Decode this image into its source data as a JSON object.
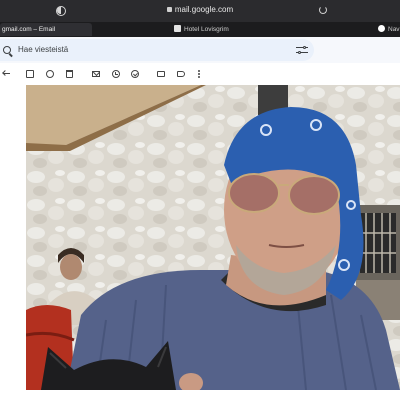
{
  "browser": {
    "url": "mail.google.com",
    "tabs": [
      {
        "label": "gmail.com – Email",
        "favicon": "gmail-favicon",
        "active": true
      },
      {
        "label": "Hotel Lovisgrim",
        "favicon": "page-favicon",
        "active": false
      },
      {
        "label": "Nav",
        "favicon": "round-favicon",
        "active": false
      }
    ]
  },
  "search": {
    "placeholder": "Hae viesteistä",
    "icon": "search-icon",
    "filter_icon": "tune-icon"
  },
  "toolbar": {
    "icons": [
      "back-icon",
      "archive-icon",
      "report-spam-icon",
      "delete-icon",
      "mark-unread-icon",
      "snooze-icon",
      "add-task-icon",
      "move-to-icon",
      "label-icon",
      "more-icon"
    ]
  },
  "email_image": {
    "description_icon": "attached-photo"
  },
  "colors": {
    "chrome_bg": "#202124",
    "search_bg": "#eaf1fb",
    "page_bg": "#f6f8fc",
    "bandana": "#2b5fb0"
  }
}
